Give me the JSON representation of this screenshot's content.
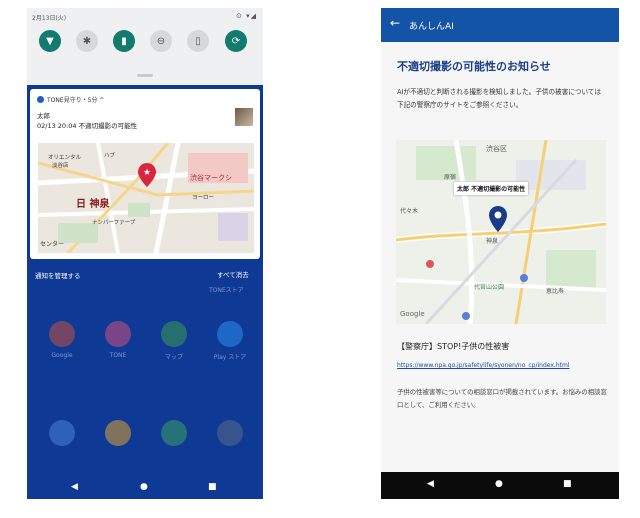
{
  "left_phone": {
    "status_time": "2月13日(火)",
    "status_icons": "⊙ ▾◢",
    "quick_settings": [
      {
        "icon": "wifi-icon",
        "glyph": "▼",
        "on": true
      },
      {
        "icon": "bluetooth-icon",
        "glyph": "✱",
        "on": false
      },
      {
        "icon": "battery-saver-icon",
        "glyph": "▮",
        "on": true
      },
      {
        "icon": "do-not-disturb-icon",
        "glyph": "⊖",
        "on": false
      },
      {
        "icon": "flashlight-icon",
        "glyph": "▯",
        "on": false
      },
      {
        "icon": "auto-rotate-icon",
        "glyph": "⟳",
        "on": true
      }
    ],
    "notification": {
      "app": "TONE見守り・5分 ^",
      "title": "太郎",
      "body": "02/13 20:04 不適切撮影の可能性",
      "map_labels": [
        "オリエンタル",
        "淡谷店",
        "ハブ",
        "日 神泉",
        "渋谷マークシ",
        "ヨーロー",
        "ナンバーファーブ",
        "センター"
      ]
    },
    "manage_label": "通知を管理する",
    "clear_all_label": "すべて消去",
    "tone_store_label": "TONEストア",
    "apps_row1": [
      {
        "name": "Google",
        "icon": "google-app-icon",
        "color": "#c9503f"
      },
      {
        "name": "TONE",
        "icon": "tone-app-icon",
        "color": "#d0507a"
      },
      {
        "name": "マップ",
        "icon": "maps-app-icon",
        "color": "#3c9b4f"
      },
      {
        "name": "Play ストア",
        "icon": "play-store-icon",
        "color": "#2d8cf0"
      }
    ],
    "apps_row2": [
      {
        "icon": "phone-app-icon",
        "color": "#4a7fd8"
      },
      {
        "icon": "chrome-app-icon",
        "color": "#e0a030"
      },
      {
        "icon": "photos-app-icon",
        "color": "#3aa060"
      },
      {
        "icon": "camera-app-icon",
        "color": "#5a6a8a"
      }
    ],
    "nav": {
      "back": "◀",
      "home": "●",
      "recents": "■"
    }
  },
  "right_phone": {
    "app_title": "あんしんAI",
    "heading": "不適切撮影の可能性のお知らせ",
    "description": "AIが不適切と判断される撮影を検知しました。子供の被害については下記の警察庁のサイトをご参照ください。",
    "map": {
      "marker_label": "太郎 不適切撮影の可能性",
      "labels": [
        "渋谷区",
        "原宿",
        "代々木",
        "神泉",
        "代官山公園",
        "Google",
        "恵比寿"
      ]
    },
    "police_title": "【警察庁】STOP!子供の性被害",
    "police_link": "https://www.npa.go.jp/safetylife/syonen/no_cp/index.html",
    "police_desc": "子供の性被害等についての相談窓口が掲載されています。お悩みの相談窓口として、ご利用ください。",
    "nav": {
      "back": "◀",
      "home": "●",
      "recents": "■"
    }
  }
}
